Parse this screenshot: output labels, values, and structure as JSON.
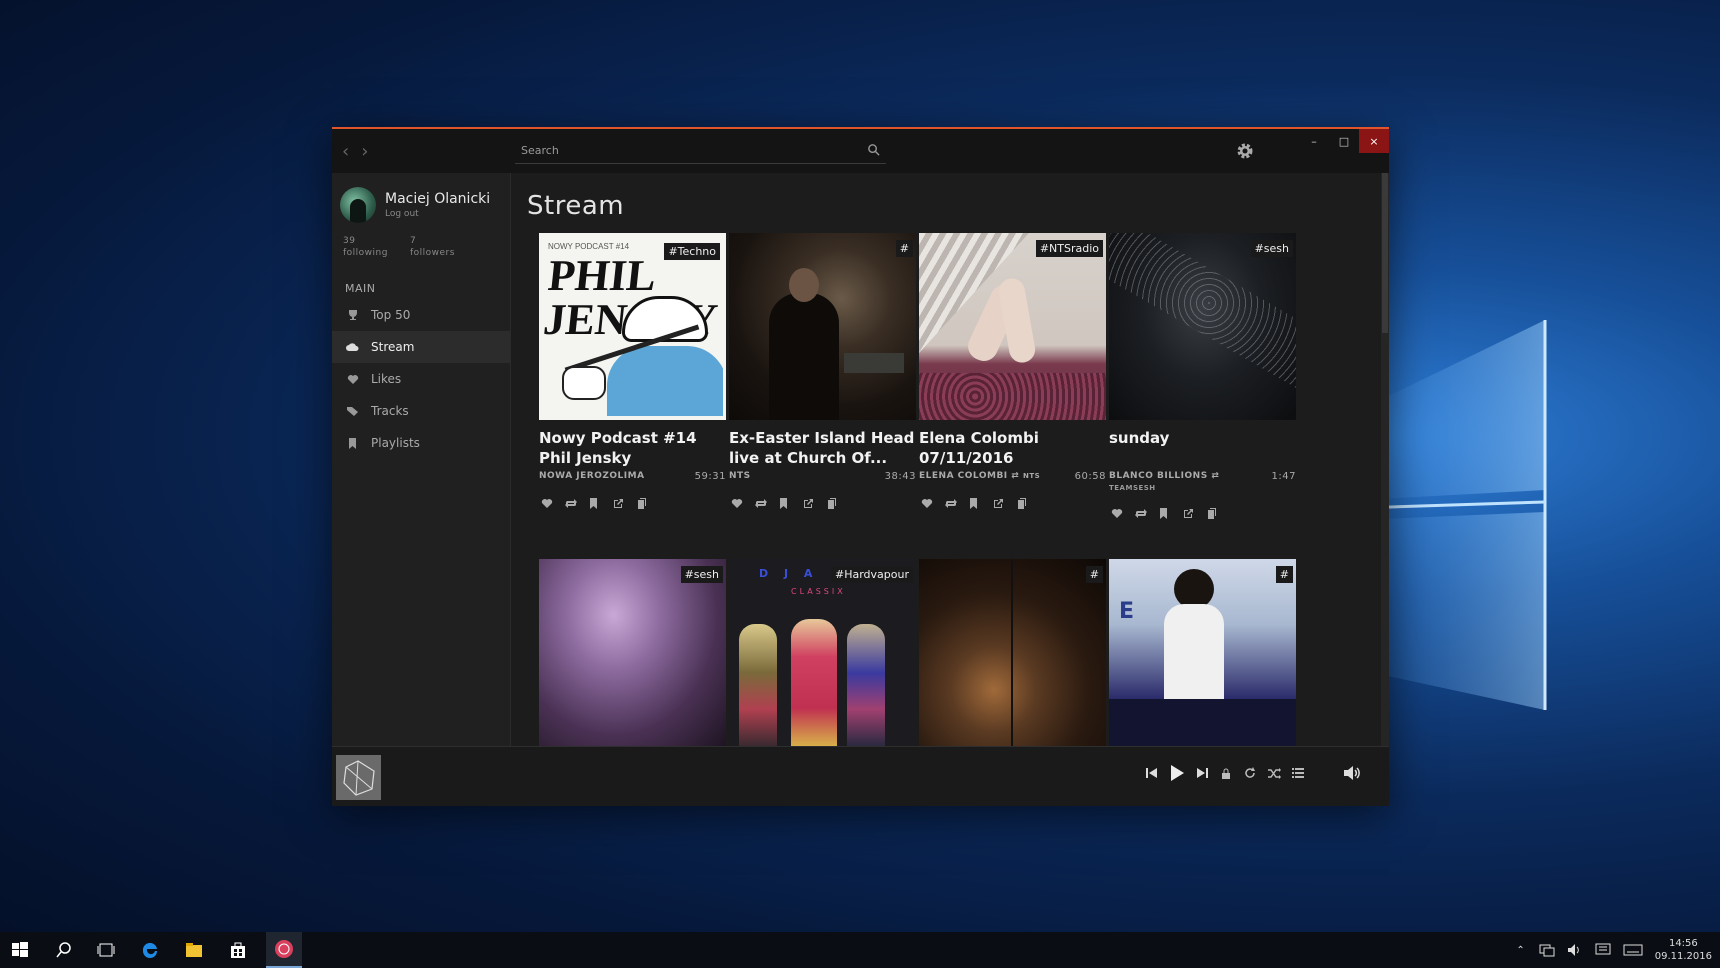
{
  "search": {
    "placeholder": "Search"
  },
  "profile": {
    "name": "Maciej Olanicki",
    "logout": "Log out",
    "following_count": "39",
    "following_label": "following",
    "followers_count": "7",
    "followers_label": "followers"
  },
  "sidebar": {
    "section": "MAIN",
    "items": [
      {
        "label": "Top 50",
        "icon": "trophy-icon"
      },
      {
        "label": "Stream",
        "icon": "cloud-icon",
        "active": true
      },
      {
        "label": "Likes",
        "icon": "heart-icon"
      },
      {
        "label": "Tracks",
        "icon": "tags-icon"
      },
      {
        "label": "Playlists",
        "icon": "bookmark-icon"
      }
    ]
  },
  "main": {
    "title": "Stream",
    "cards": [
      {
        "tag": "#Techno",
        "title": "Nowy Podcast #14 Phil Jensky",
        "artist": "NOWA JEROZOLIMA",
        "duration": "59:31",
        "art_text_small": "NOWY PODCAST #14",
        "art_text_big": "PHIL JENSKY"
      },
      {
        "tag": "#",
        "title": "Ex-Easter Island Head live at Church Of...",
        "artist": "NTS",
        "duration": "38:43"
      },
      {
        "tag": "#NTSradio",
        "title": "Elena Colombi 07/11/2016",
        "artist": "ELENA COLOMBI",
        "repost_label": "NTS",
        "duration": "60:58"
      },
      {
        "tag": "#sesh",
        "title": "sunday",
        "artist": "BLANCO BILLIONS",
        "sub": "TEAMSESH",
        "duration": "1:47"
      },
      {
        "tag": "#sesh"
      },
      {
        "tag": "#Hardvapour",
        "art_text_top": "D J   A",
        "art_text_sub": "CLASSIX"
      },
      {
        "tag": "#"
      },
      {
        "tag": "#"
      }
    ]
  },
  "taskbar": {
    "time": "14:56",
    "date": "09.11.2016"
  },
  "colors": {
    "accent": "#e0552c",
    "close": "#8b1414",
    "background": "#1c1c1c"
  }
}
